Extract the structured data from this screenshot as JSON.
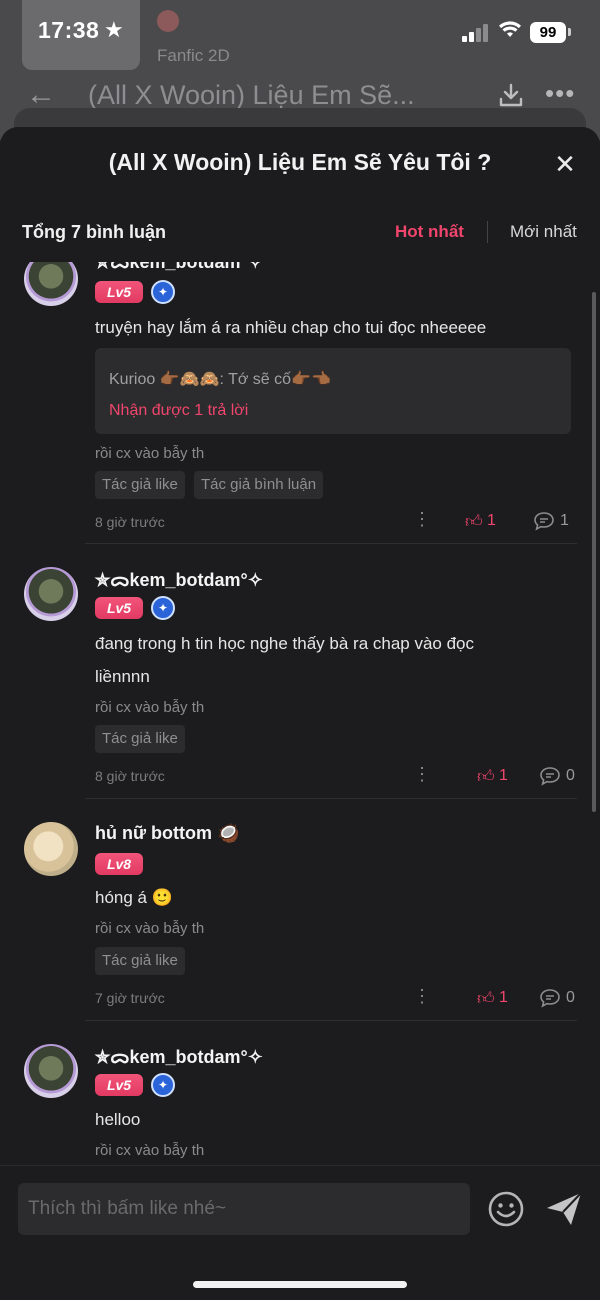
{
  "status_bar": {
    "time": "17:38",
    "battery": "99"
  },
  "background_app": {
    "subtitle": "Fanfic 2D",
    "title": "(All X Wooin) Liệu Em Sẽ..."
  },
  "sheet": {
    "title": "(All X Wooin) Liệu Em Sẽ Yêu Tôi ?",
    "count_label": "Tổng 7 bình luận",
    "sort_hot": "Hot nhất",
    "sort_new": "Mới nhất"
  },
  "comments": [
    {
      "username": "✮ᯅkem_botdam°✧",
      "level": "Lv5",
      "text": "truyện hay lắm á ra nhiều chap cho tui đọc nheeeee",
      "reply_preview": "Kurioo 👉🏾🙈🙈: Tớ sẽ cố👉🏾👈🏾",
      "reply_link": "Nhận được 1 trả lời",
      "signature": "rồi cx vào bẫy th",
      "tags": [
        "Tác giả like",
        "Tác giả bình luận"
      ],
      "time": "8 giờ trước",
      "likes": "1",
      "replies": "1"
    },
    {
      "username": "✮ᯅkem_botdam°✧",
      "level": "Lv5",
      "text_line1": "đang trong h tin học nghe thấy bà ra chap vào đọc",
      "text_line2": "liềnnnn",
      "signature": "rồi cx vào bẫy th",
      "tags": [
        "Tác giả like"
      ],
      "time": "8 giờ trước",
      "likes": "1",
      "replies": "0"
    },
    {
      "username": "hủ nữ bottom 🥥",
      "level": "Lv8",
      "text": "hóng á 🙂",
      "signature": "rồi cx vào bẫy th",
      "tags": [
        "Tác giả like"
      ],
      "time": "7 giờ trước",
      "likes": "1",
      "replies": "0"
    },
    {
      "username": "✮ᯅkem_botdam°✧",
      "level": "Lv5",
      "text": "helloo",
      "signature": "rồi cx vào bẫy th"
    }
  ],
  "input": {
    "placeholder": "Thích thì bấm like nhé~"
  },
  "colors": {
    "accent": "#f0456c",
    "sheet_bg": "#1c1c1e",
    "level_badge": "#e23a62",
    "medal": "#2b63d9"
  },
  "icons": [
    "star-icon",
    "signal-icon",
    "wifi-icon",
    "back-arrow-icon",
    "download-icon",
    "more-icon",
    "close-icon",
    "medal-icon",
    "dots-icon",
    "thumbs-up-icon",
    "reply-bubble-icon",
    "emoji-icon",
    "send-icon"
  ]
}
